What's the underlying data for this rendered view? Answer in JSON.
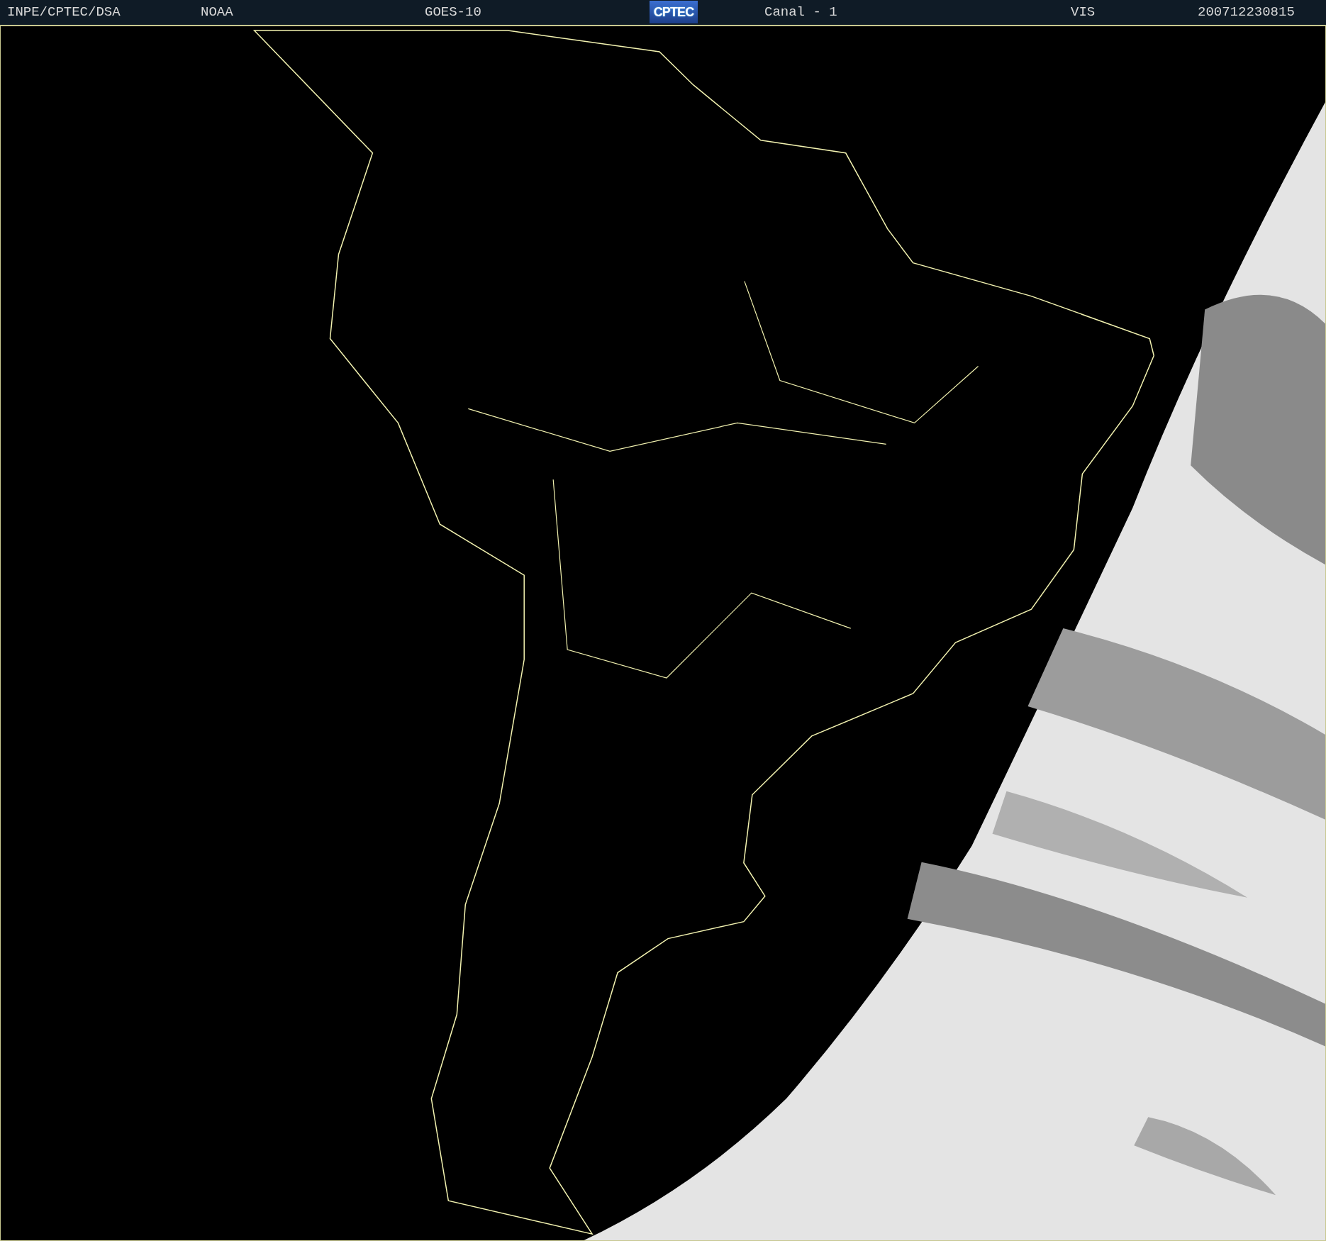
{
  "header": {
    "items": [
      {
        "kind": "text",
        "label": "INPE/CPTEC/DSA"
      },
      {
        "kind": "text",
        "label": "NOAA"
      },
      {
        "kind": "text",
        "label": "GOES-10"
      },
      {
        "kind": "logo",
        "label": "CPTEC"
      },
      {
        "kind": "text",
        "label": "Canal - 1"
      },
      {
        "kind": "text",
        "label": "VIS"
      },
      {
        "kind": "text",
        "label": "200712230815"
      }
    ]
  }
}
